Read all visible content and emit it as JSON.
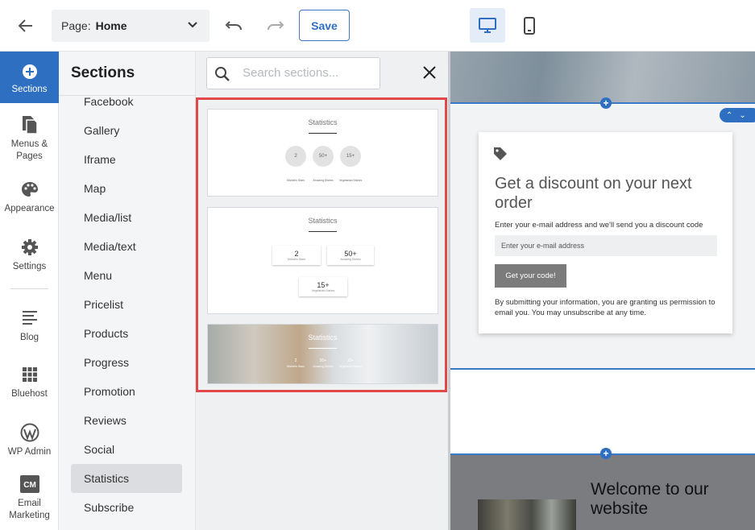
{
  "topbar": {
    "page_label": "Page:",
    "page_value": "Home",
    "save_label": "Save"
  },
  "rail": {
    "items": [
      {
        "label": "Sections",
        "icon": "plus-circle-icon"
      },
      {
        "label": "Menus &\nPages",
        "icon": "pages-icon"
      },
      {
        "label": "Appearance",
        "icon": "palette-icon"
      },
      {
        "label": "Settings",
        "icon": "gear-icon"
      },
      {
        "label": "Blog",
        "icon": "blog-icon"
      },
      {
        "label": "Bluehost",
        "icon": "grid-icon"
      },
      {
        "label": "WP Admin",
        "icon": "wordpress-icon"
      },
      {
        "label": "Email\nMarketing",
        "icon": "cm-icon"
      }
    ]
  },
  "sections": {
    "title": "Sections",
    "items": [
      "Facebook",
      "Gallery",
      "Iframe",
      "Map",
      "Media/list",
      "Media/text",
      "Menu",
      "Pricelist",
      "Products",
      "Progress",
      "Promotion",
      "Reviews",
      "Social",
      "Statistics",
      "Subscribe"
    ],
    "active": "Statistics"
  },
  "gallery": {
    "search_placeholder": "Search sections...",
    "thumbs": [
      {
        "title": "Statistics",
        "stats": [
          {
            "value": "2",
            "label": "Michelin Stars"
          },
          {
            "value": "50+",
            "label": "Amazing Dishes"
          },
          {
            "value": "15+",
            "label": "Vegetarian Dishes"
          }
        ]
      },
      {
        "title": "Statistics",
        "stats": [
          {
            "value": "2",
            "label": "Michelin Stars"
          },
          {
            "value": "50+",
            "label": "Amazing Dishes"
          },
          {
            "value": "15+",
            "label": "Vegetarian Dishes"
          }
        ]
      },
      {
        "title": "Statistics",
        "stats": [
          {
            "value": "2",
            "label": "Michelin Stars"
          },
          {
            "value": "50+",
            "label": "Amazing Dishes"
          },
          {
            "value": "15+",
            "label": "Vegetarian Dishes"
          }
        ]
      }
    ]
  },
  "preview": {
    "discount": {
      "title": "Get a discount on your next order",
      "text": "Enter your e-mail address and we'll send you a discount code",
      "input_placeholder": "Enter your e-mail address",
      "button": "Get your code!",
      "note": "By submitting your information, you are granting us permission to email you. You may unsubscribe at any time."
    },
    "welcome": {
      "title": "Welcome to our website"
    }
  },
  "colors": {
    "accent": "#2e6fc2",
    "highlight": "#e0484b"
  }
}
